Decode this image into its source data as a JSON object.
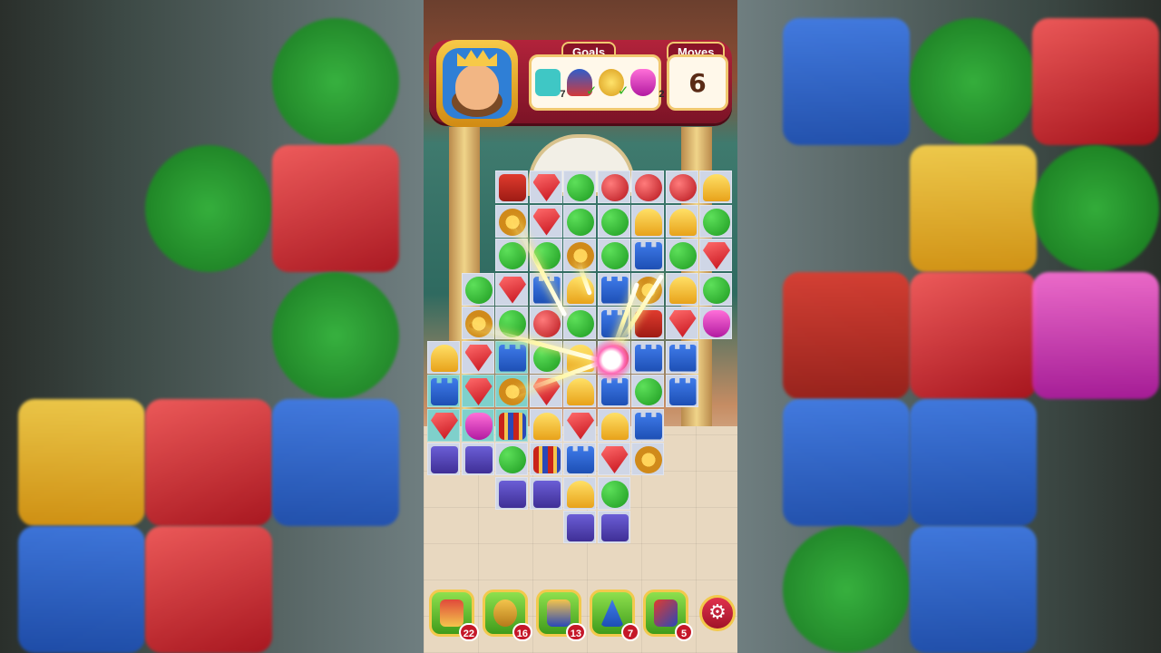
{
  "header": {
    "goals_label": "Goals",
    "moves_label": "Moves",
    "moves_value": "6",
    "goals": [
      {
        "icon": "teal-tile-icon",
        "count": "7"
      },
      {
        "icon": "king-figure-icon",
        "count": "✓"
      },
      {
        "icon": "golden-pot-icon",
        "count": "✓"
      },
      {
        "icon": "pink-tulip-icon",
        "count": "2"
      }
    ]
  },
  "boosters": [
    {
      "icon": "hammer-icon",
      "count": "22"
    },
    {
      "icon": "cannon-icon",
      "count": "16"
    },
    {
      "icon": "arrow-icon",
      "count": "13"
    },
    {
      "icon": "wizard-hat-icon",
      "count": "7"
    },
    {
      "icon": "jester-hat-icon",
      "count": "5"
    }
  ],
  "settings_icon": "gear-icon"
}
